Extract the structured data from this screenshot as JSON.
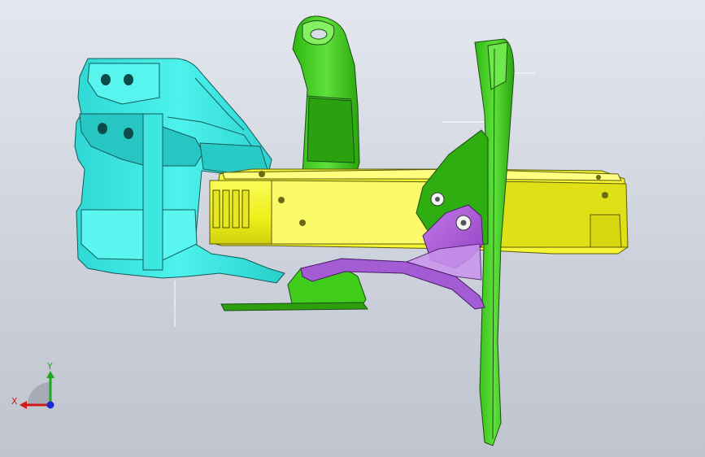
{
  "viewport": {
    "background_top": "#e4e7ee",
    "background_bottom": "#bfc4cf"
  },
  "colors": {
    "cyan_part": "#35e8e2",
    "yellow_part": "#f2f21c",
    "green_part": "#3fce1a",
    "purple_part": "#b05ad8",
    "edge": "#1f4a1f"
  },
  "triad": {
    "x_label": "X",
    "y_label": "Y",
    "x_color": "#d11a1a",
    "y_color": "#1fa81f",
    "z_color": "#1a2bd1"
  }
}
